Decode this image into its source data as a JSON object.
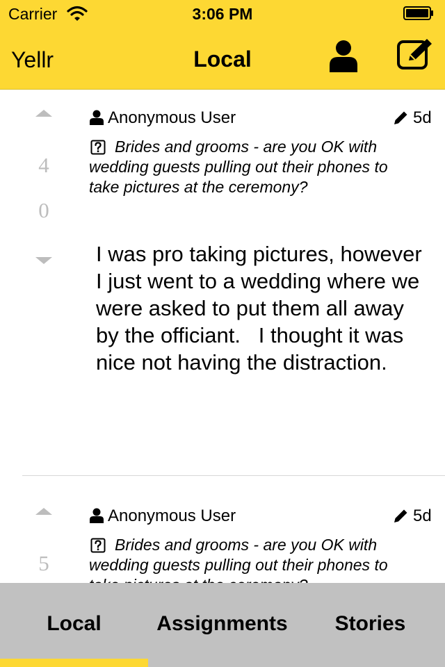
{
  "status_bar": {
    "carrier": "Carrier",
    "time": "3:06 PM"
  },
  "nav": {
    "brand": "Yellr",
    "title": "Local"
  },
  "colors": {
    "accent": "#fdd833",
    "tab_bar": "#c1c1c1",
    "score": "#bdbdbd"
  },
  "posts": [
    {
      "score_up": "4",
      "score_down": "0",
      "author": "Anonymous User",
      "age": "5d",
      "question": "Brides and grooms - are you OK with wedding guests pulling out their phones to take pictures at the ceremony?",
      "body": "I was pro taking pictures, however I just went to a wedding where we were asked to put them all away by the officiant.   I thought it was nice not having the distraction."
    },
    {
      "score_up": "5",
      "author": "Anonymous User",
      "age": "5d",
      "question": "Brides and grooms - are you OK with wedding guests pulling out their phones to take pictures at the ceremony?"
    }
  ],
  "tabs": [
    {
      "label": "Local",
      "active": true
    },
    {
      "label": "Assignments",
      "active": false
    },
    {
      "label": "Stories",
      "active": false
    }
  ],
  "icons": [
    "wifi-icon",
    "battery-icon",
    "profile-icon",
    "compose-icon",
    "upvote-icon",
    "downvote-icon",
    "user-icon",
    "pencil-icon",
    "question-icon"
  ]
}
